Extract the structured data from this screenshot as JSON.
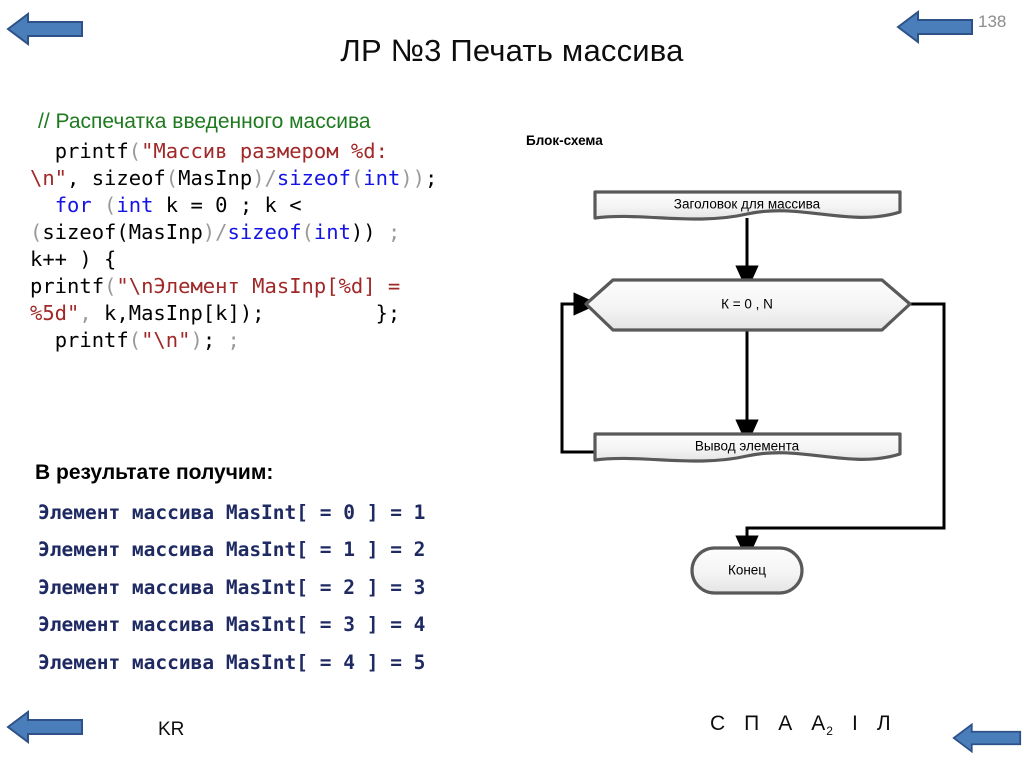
{
  "page": {
    "number": "138",
    "title": "ЛР №3 Печать массива",
    "accent_arrow_fill": "#4a7ebb",
    "accent_arrow_stroke": "#2e5288",
    "page_number_color": "#8c8c8c"
  },
  "navigation": {
    "top_left_arrow": "left-arrow-icon",
    "top_right_arrow": "left-arrow-icon",
    "bottom_left_arrow": "left-arrow-icon",
    "bottom_right_arrow": "left-arrow-icon"
  },
  "code": {
    "comment": "// Распечатка введенного массива",
    "comment_color": "#1e7a1e",
    "keyword_color": "#1414e6",
    "string_color": "#a02828",
    "punct_color": "#9a9a9a",
    "lines": [
      [
        {
          "t": "  printf",
          "c": "pl"
        },
        {
          "t": "(",
          "c": "pun"
        },
        {
          "t": "\"Массив размером %d:\n\\n\"",
          "c": "str"
        },
        {
          "t": ", sizeof",
          "c": "pl"
        },
        {
          "t": "(",
          "c": "pun"
        },
        {
          "t": "MasInp",
          "c": "pl"
        },
        {
          "t": ")/",
          "c": "pun"
        },
        {
          "t": "sizeof",
          "c": "kw"
        },
        {
          "t": "(",
          "c": "pun"
        },
        {
          "t": "int",
          "c": "kw"
        },
        {
          "t": "))",
          "c": "pun"
        },
        {
          "t": ";",
          "c": "pl"
        }
      ],
      [
        {
          "t": "  ",
          "c": "pl"
        },
        {
          "t": "for",
          "c": "kw"
        },
        {
          "t": " (",
          "c": "pun"
        },
        {
          "t": "int",
          "c": "kw"
        },
        {
          "t": " k = 0 ; k < \n",
          "c": "pl"
        },
        {
          "t": "(",
          "c": "pun"
        },
        {
          "t": "sizeof(MasInp",
          "c": "pl"
        },
        {
          "t": ")/",
          "c": "pun"
        },
        {
          "t": "sizeof",
          "c": "kw"
        },
        {
          "t": "(",
          "c": "pun"
        },
        {
          "t": "int",
          "c": "kw"
        },
        {
          "t": "))",
          "c": "pl"
        },
        {
          "t": " ;",
          "c": "pun"
        },
        {
          "t": "\nk++ ) {",
          "c": "pl"
        }
      ],
      [
        {
          "t": "printf",
          "c": "pl"
        },
        {
          "t": "(",
          "c": "pun"
        },
        {
          "t": "\"\\nЭлемент MasInp[%d] =\n%5d\"",
          "c": "str"
        },
        {
          "t": ",",
          "c": "pun"
        },
        {
          "t": " k,MasInp[k]);         };",
          "c": "pl"
        }
      ],
      [
        {
          "t": "  printf",
          "c": "pl"
        },
        {
          "t": "(",
          "c": "pun"
        },
        {
          "t": "\"\\n\"",
          "c": "str"
        },
        {
          "t": ")",
          "c": "pun"
        },
        {
          "t": ";",
          "c": "pl"
        },
        {
          "t": " ;",
          "c": "pun"
        }
      ]
    ]
  },
  "result": {
    "heading": "В результате получим:",
    "text_color": "#1f2a63",
    "lines": [
      "Элемент массива MasInt[ = 0 ] = 1",
      "Элемент массива MasInt[ = 1 ] = 2",
      "Элемент массива MasInt[ = 2 ] = 3",
      "Элемент массива MasInt[ = 3 ] = 4",
      "Элемент массива MasInt[ = 4 ] = 5"
    ]
  },
  "flowchart": {
    "label": "Блок-схема",
    "node_fill_top": "#fdfdfd",
    "node_fill_bottom": "#e8e8e8",
    "node_stroke": "#595959",
    "connector_color": "#000000",
    "nodes": [
      {
        "id": "header",
        "shape": "document",
        "label": "Заголовок для массива"
      },
      {
        "id": "loop",
        "shape": "hexagon",
        "label": "К = 0 , N"
      },
      {
        "id": "output",
        "shape": "document",
        "label": "Вывод элемента"
      },
      {
        "id": "end",
        "shape": "terminator",
        "label": "Конец"
      }
    ]
  },
  "footer": {
    "label": "KR",
    "letters": [
      {
        "char": "С",
        "sub": ""
      },
      {
        "char": "П",
        "sub": ""
      },
      {
        "char": "А",
        "sub": ""
      },
      {
        "char": "А",
        "sub": "2"
      },
      {
        "char": "І",
        "sub": ""
      },
      {
        "char": "Л",
        "sub": ""
      }
    ]
  }
}
